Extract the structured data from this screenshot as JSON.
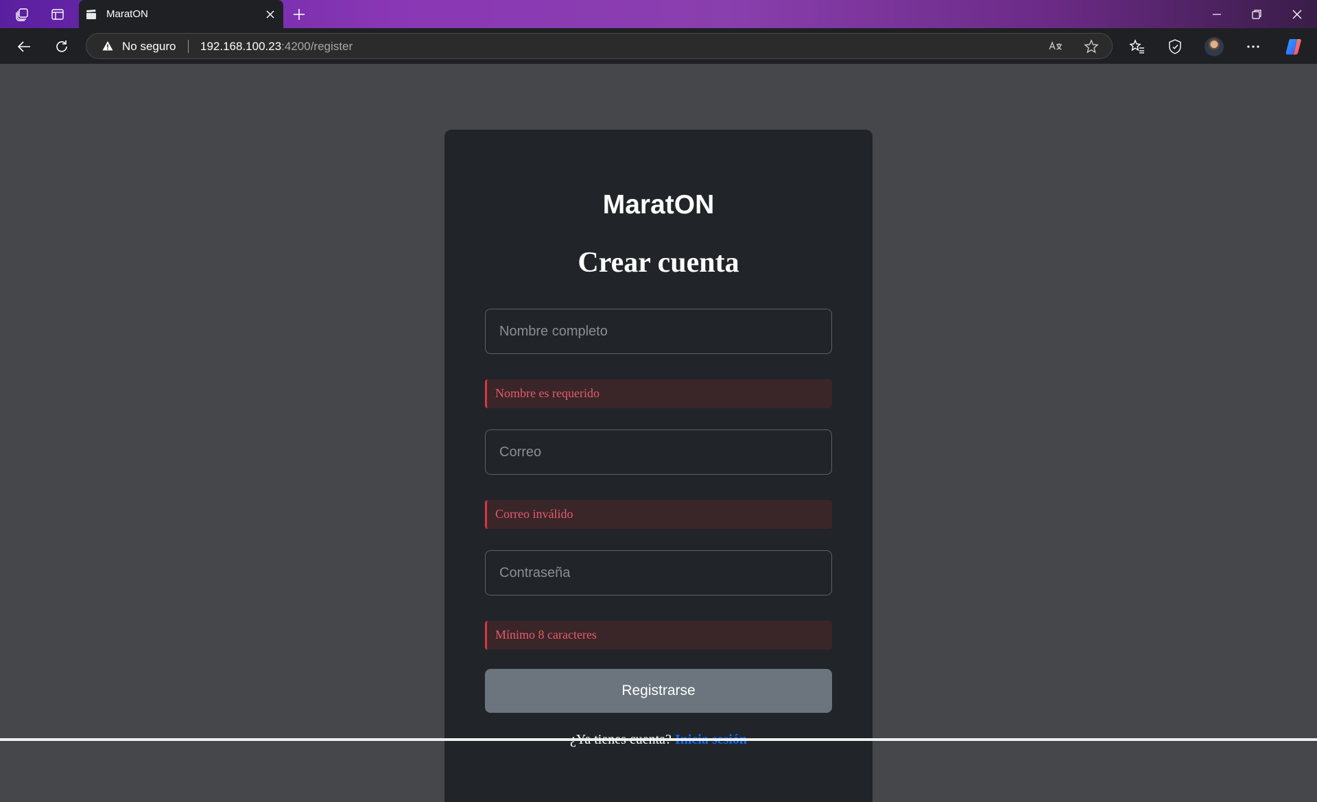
{
  "browser": {
    "tab": {
      "title": "MaratON"
    },
    "address": {
      "security_label": "No seguro",
      "url_host": "192.168.100.23",
      "url_rest": ":4200/register"
    }
  },
  "page": {
    "brand": "MaratON",
    "heading": "Crear cuenta",
    "fields": {
      "name": {
        "placeholder": "Nombre completo",
        "value": "",
        "error": "Nombre es requerido"
      },
      "email": {
        "placeholder": "Correo",
        "value": "",
        "error": "Correo inválido"
      },
      "password": {
        "placeholder": "Contraseña",
        "value": "",
        "error": "Mínimo 8 caracteres"
      }
    },
    "submit_label": "Registrarse",
    "login_prompt": "¿Ya tienes cuenta?",
    "login_link": "Inicia sesión"
  },
  "icons": {
    "tab_actions": "tab-actions-icon",
    "vertical_tabs": "vertical-tabs-icon",
    "favicon": "clapperboard-icon",
    "warning": "warning-icon",
    "translate": "translate-icon",
    "favorite": "star-icon"
  },
  "colors": {
    "page_bg": "#45474a",
    "card_bg": "#212529",
    "error_text": "#e35d6a",
    "error_border": "#dc3545",
    "button_bg": "#6c757d",
    "link": "#0d6efd"
  }
}
